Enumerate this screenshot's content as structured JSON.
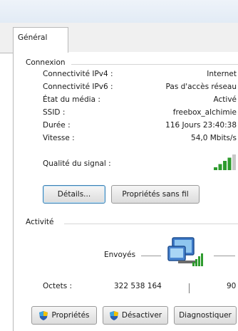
{
  "tabs": [
    {
      "label": "Général"
    }
  ],
  "connection": {
    "title": "Connexion",
    "rows": [
      {
        "label": "Connectivité IPv4 :",
        "value": "Internet"
      },
      {
        "label": "Connectivité IPv6 :",
        "value": "Pas d'accès réseau"
      },
      {
        "label": "État du média :",
        "value": "Activé"
      },
      {
        "label": "SSID :",
        "value": "freebox_alchimie"
      },
      {
        "label": "Durée :",
        "value": "116 Jours 23:40:38"
      },
      {
        "label": "Vitesse :",
        "value": "54,0 Mbits/s"
      }
    ],
    "signal_label": "Qualité du signal :",
    "signal_bars_lit": 4,
    "signal_bars_total": 5
  },
  "buttons_mid": {
    "details": "Détails...",
    "wireless_props": "Propriétés sans fil"
  },
  "activity": {
    "title": "Activité",
    "sent_label": "Envoyés",
    "bytes_label": "Octets :",
    "sent_bytes": "322 538 164",
    "received_bytes_partial": "90"
  },
  "buttons_bottom": {
    "properties": "Propriétés",
    "disable": "Désactiver",
    "diagnose": "Diagnostiquer"
  },
  "colors": {
    "signal_green": "#2e9b2e",
    "shield_blue": "#2b5fae",
    "shield_yellow": "#f2c200"
  }
}
